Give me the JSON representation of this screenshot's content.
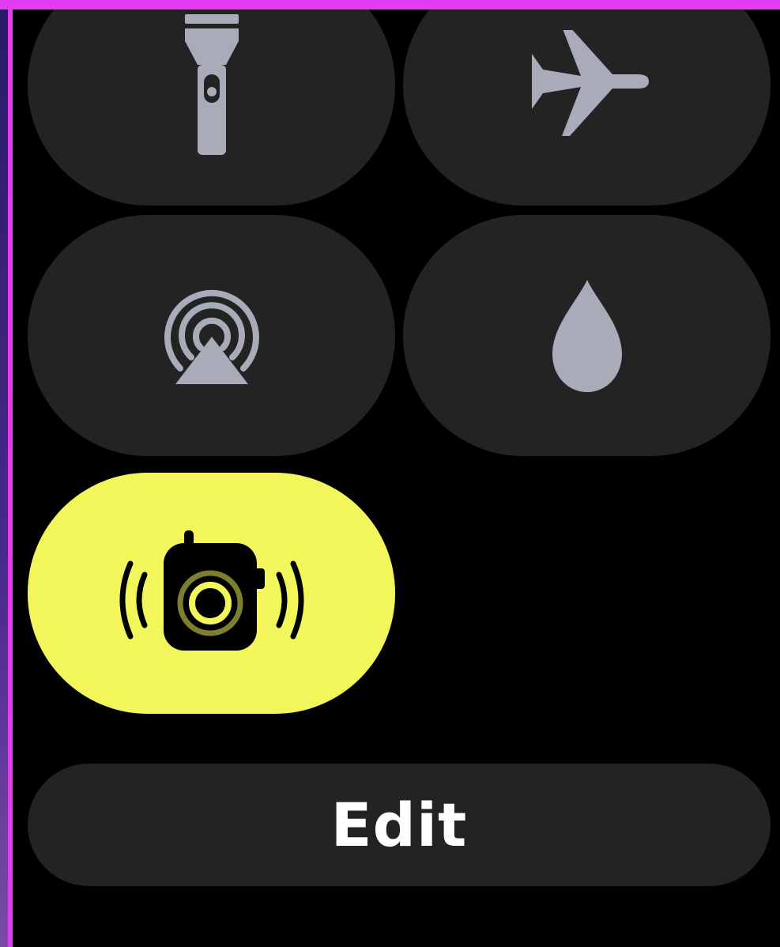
{
  "control_center": {
    "tiles": [
      {
        "id": "flashlight",
        "icon": "flashlight-icon",
        "active": false
      },
      {
        "id": "airplane-mode",
        "icon": "airplane-icon",
        "active": false
      },
      {
        "id": "airplay",
        "icon": "airplay-icon",
        "active": false
      },
      {
        "id": "water-lock",
        "icon": "water-drop-icon",
        "active": false
      },
      {
        "id": "walkie-talkie",
        "icon": "walkie-talkie-icon",
        "active": true
      }
    ],
    "edit_label": "Edit"
  },
  "colors": {
    "tile_background": "#232323",
    "icon_inactive": "#a7acb8",
    "tile_active": "#f3f65b",
    "icon_active": "#000000",
    "screen_background": "#000000",
    "frame_accent": "#e43cf0"
  }
}
